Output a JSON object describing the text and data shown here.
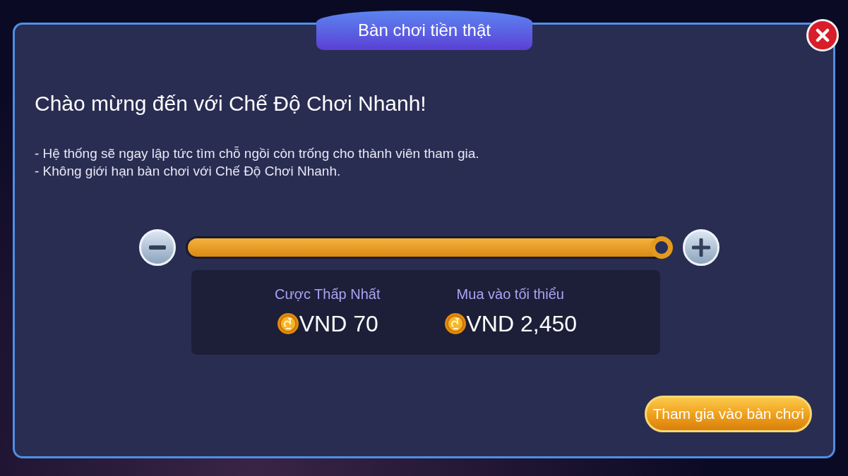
{
  "dialog": {
    "title": "Bàn chơi tiền thật",
    "heading": "Chào mừng đến với Chế Độ Chơi Nhanh!",
    "notes": [
      "- Hệ thống sẽ ngay lập tức tìm chỗ ngồi còn trống cho thành viên tham gia.",
      "- Không giới hạn bàn chơi với Chế Độ Chơi Nhanh."
    ],
    "stake_slider": {
      "level": 1
    },
    "stats": [
      {
        "label": "Cược Thấp Nhất",
        "value": "VND 70"
      },
      {
        "label": "Mua vào tối thiểu",
        "value": "VND 2,450"
      }
    ],
    "join_button": "Tham gia vào bàn chơi"
  }
}
